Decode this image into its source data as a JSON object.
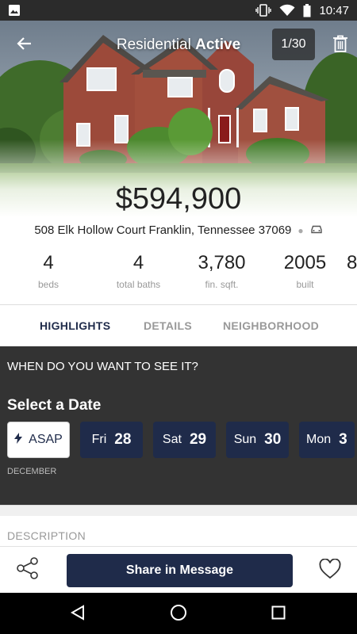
{
  "status_bar": {
    "time": "10:47"
  },
  "header": {
    "title_prefix": "Residential",
    "title_status": "Active",
    "photo_counter": "1/30"
  },
  "listing": {
    "price": "$594,900",
    "address": "508 Elk Hollow Court Franklin, Tennessee 37069"
  },
  "stats": [
    {
      "value": "4",
      "label": "beds"
    },
    {
      "value": "4",
      "label": "total baths"
    },
    {
      "value": "3,780",
      "label": "fin. sqft."
    },
    {
      "value": "2005",
      "label": "built"
    },
    {
      "value": "8",
      "label": ""
    }
  ],
  "tabs": [
    {
      "label": "HIGHLIGHTS",
      "active": true
    },
    {
      "label": "DETAILS",
      "active": false
    },
    {
      "label": "NEIGHBORHOOD",
      "active": false
    }
  ],
  "schedule": {
    "question": "WHEN DO YOU WANT TO SEE IT?",
    "select_label": "Select a Date",
    "asap_label": "ASAP",
    "dates": [
      {
        "day": "Fri",
        "date": "28"
      },
      {
        "day": "Sat",
        "date": "29"
      },
      {
        "day": "Sun",
        "date": "30"
      },
      {
        "day": "Mon",
        "date": "3"
      }
    ],
    "month": "DECEMBER"
  },
  "description_label": "DESCRIPTION",
  "actions": {
    "share_message_label": "Share in Message"
  },
  "colors": {
    "navy": "#1f2b4a",
    "dark_panel": "#333333"
  },
  "icons": [
    "image-icon",
    "vibrate-icon",
    "wifi-icon",
    "battery-icon",
    "back-arrow-icon",
    "trash-icon",
    "car-icon",
    "flash-icon",
    "share-icon",
    "heart-icon",
    "nav-back-icon",
    "nav-home-icon",
    "nav-recents-icon"
  ]
}
